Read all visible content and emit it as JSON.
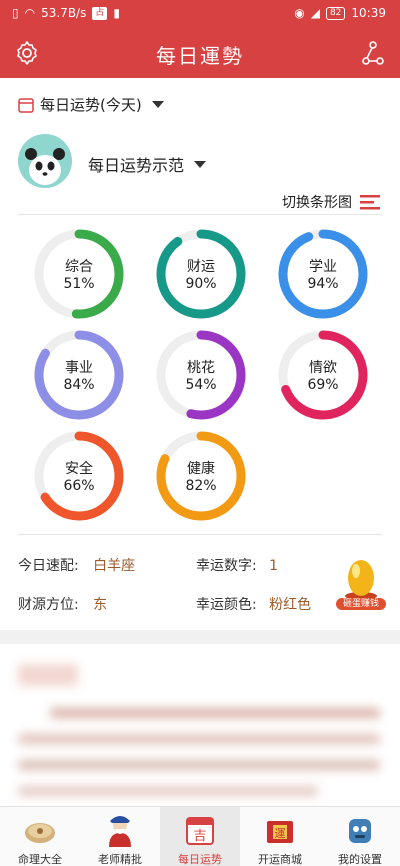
{
  "status_bar": {
    "speed": "53.7B/s",
    "badge": "占",
    "battery": "82",
    "time": "10:39"
  },
  "header": {
    "title": "每日運勢"
  },
  "date_selector": {
    "label": "每日运势(今天)"
  },
  "profile": {
    "name": "每日运势示范"
  },
  "view_switch": {
    "label": "切换条形图"
  },
  "fortunes": [
    {
      "name": "综合",
      "percent": "51%",
      "value": 51,
      "color": "#3aaa4a"
    },
    {
      "name": "财运",
      "percent": "90%",
      "value": 90,
      "color": "#17998a"
    },
    {
      "name": "学业",
      "percent": "94%",
      "value": 94,
      "color": "#3a8fe8"
    },
    {
      "name": "事业",
      "percent": "84%",
      "value": 84,
      "color": "#8d8ee6"
    },
    {
      "name": "桃花",
      "percent": "54%",
      "value": 54,
      "color": "#9b35c4"
    },
    {
      "name": "情欲",
      "percent": "69%",
      "value": 69,
      "color": "#e0245e"
    },
    {
      "name": "安全",
      "percent": "66%",
      "value": 66,
      "color": "#f0562b"
    },
    {
      "name": "健康",
      "percent": "82%",
      "value": 82,
      "color": "#f39a14"
    }
  ],
  "ring_track_color": "#eeeeee",
  "info": {
    "match_label": "今日速配:",
    "match_value": "白羊座",
    "number_label": "幸运数字:",
    "number_value": "1",
    "direction_label": "财源方位:",
    "direction_value": "东",
    "color_label": "幸运颜色:",
    "color_value": "粉红色",
    "egg_label": "砸蛋赚钱"
  },
  "bottom_nav": [
    {
      "label": "命理大全",
      "icon": "fortune-wheel-icon"
    },
    {
      "label": "老师精批",
      "icon": "master-icon"
    },
    {
      "label": "每日运势",
      "icon": "calendar-ji-icon"
    },
    {
      "label": "开运商城",
      "icon": "shop-icon"
    },
    {
      "label": "我的设置",
      "icon": "profile-settings-icon"
    }
  ]
}
